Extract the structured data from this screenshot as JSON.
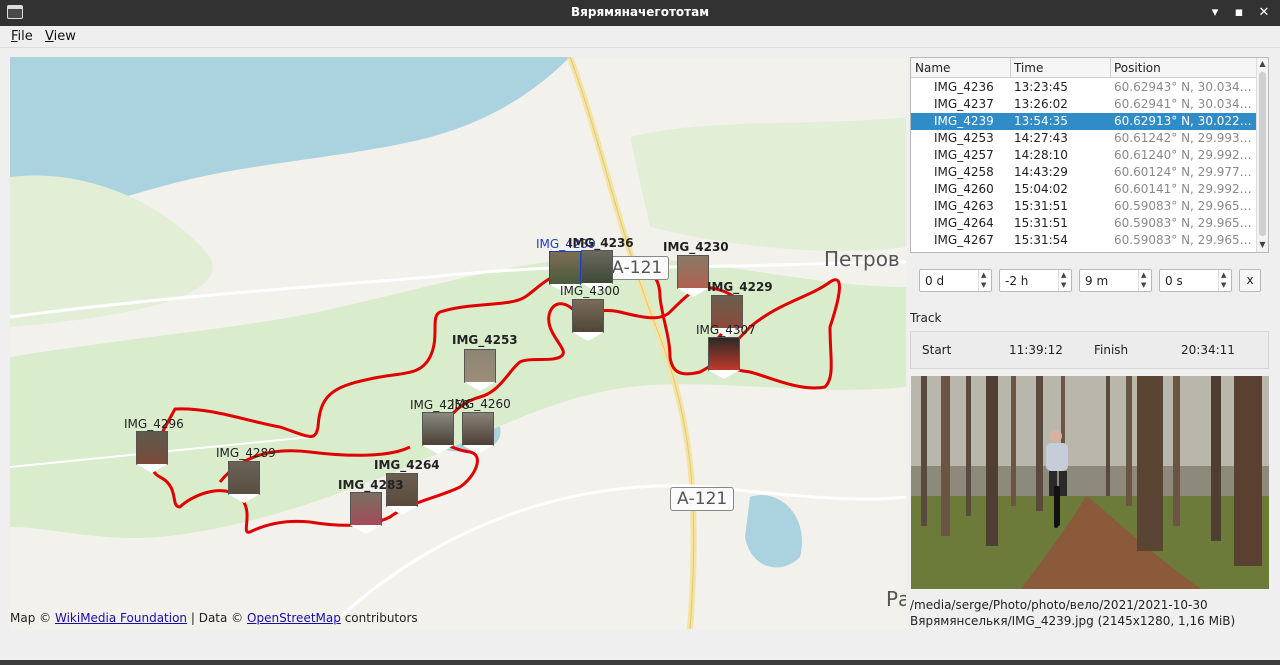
{
  "window": {
    "title": "Вярямяначегототам",
    "minimize_glyph": "▾",
    "maximize_glyph": "▪",
    "close_glyph": "✕"
  },
  "menu": [
    {
      "label": "File",
      "mnemonic": "F",
      "rest": "ile"
    },
    {
      "label": "View",
      "mnemonic": "V",
      "rest": "iew"
    }
  ],
  "map": {
    "place_labels": [
      "Петров",
      "Ра"
    ],
    "road_signs": [
      "А-121",
      "А-121"
    ],
    "markers": [
      {
        "label": "IMG_4239",
        "style": "sel"
      },
      {
        "label": "IMG_4236",
        "style": "bold"
      },
      {
        "label": "IMG_4230",
        "style": "bold"
      },
      {
        "label": "IMG_4300",
        "style": "normal"
      },
      {
        "label": "IMG_4229",
        "style": "bold"
      },
      {
        "label": "IMG_4307",
        "style": "normal"
      },
      {
        "label": "IMG_4253",
        "style": "bold"
      },
      {
        "label": "IMG_4258",
        "style": "normal"
      },
      {
        "label": "IMG_4260",
        "style": "normal"
      },
      {
        "label": "IMG_4296",
        "style": "normal"
      },
      {
        "label": "IMG_4289",
        "style": "normal"
      },
      {
        "label": "IMG_4264",
        "style": "bold"
      },
      {
        "label": "IMG_4283",
        "style": "bold"
      }
    ],
    "attribution": {
      "prefix": "Map ©",
      "link1": "WikiMedia Foundation",
      "middle": "| Data ©",
      "link2": "OpenStreetMap",
      "suffix": "contributors"
    }
  },
  "photo_table": {
    "columns": [
      "Name",
      "Time",
      "Position"
    ],
    "rows": [
      {
        "name": "IMG_4236",
        "time": "13:23:45",
        "position": "60.62943° N, 30.03411..."
      },
      {
        "name": "IMG_4237",
        "time": "13:26:02",
        "position": "60.62941° N, 30.03402..."
      },
      {
        "name": "IMG_4239",
        "time": "13:54:35",
        "position": "60.62913° N, 30.02262...",
        "selected": true
      },
      {
        "name": "IMG_4253",
        "time": "14:27:43",
        "position": "60.61242° N, 29.99300..."
      },
      {
        "name": "IMG_4257",
        "time": "14:28:10",
        "position": "60.61240° N, 29.99292..."
      },
      {
        "name": "IMG_4258",
        "time": "14:43:29",
        "position": "60.60124° N, 29.97799..."
      },
      {
        "name": "IMG_4260",
        "time": "15:04:02",
        "position": "60.60141° N, 29.99211..."
      },
      {
        "name": "IMG_4263",
        "time": "15:31:51",
        "position": "60.59083° N, 29.96548..."
      },
      {
        "name": "IMG_4264",
        "time": "15:31:51",
        "position": "60.59083° N, 29.96548..."
      },
      {
        "name": "IMG_4267",
        "time": "15:31:54",
        "position": "60.59083° N, 29.96547..."
      }
    ]
  },
  "time_offset": {
    "days": "0 d",
    "hours": "-2 h",
    "minutes": "9 m",
    "seconds": "0 s",
    "clear_label": "x"
  },
  "track": {
    "title": "Track",
    "start_label": "Start",
    "start_time": "11:39:12",
    "finish_label": "Finish",
    "finish_time": "20:34:11"
  },
  "photo_info": {
    "line1": "/media/serge/Photo/photo/вело/2021/2021-10-30",
    "line2": "Вярямянселькя/IMG_4239.jpg (2145x1280, 1,16 MiB)"
  },
  "colors": {
    "track": "#e00000",
    "selection": "#308cc6",
    "water": "#aad3df",
    "forest": "#d9eccb"
  }
}
